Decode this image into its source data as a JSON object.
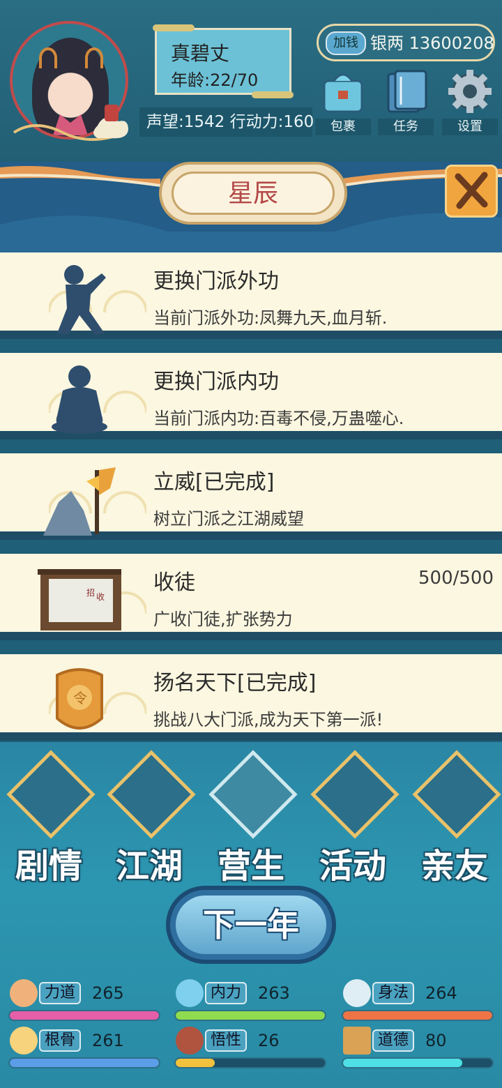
{
  "header": {
    "name": "真碧丈",
    "age": "年龄:22/70",
    "stats_line": "声望:1542 行动力:160",
    "money_button": "加钱",
    "money_text": "银两 13600208",
    "icons": [
      {
        "label": "包裹",
        "icon": "bag-icon",
        "color": "#6ec6de"
      },
      {
        "label": "任务",
        "icon": "task-book-icon",
        "color": "#5a9bc8"
      },
      {
        "label": "设置",
        "icon": "gear-icon",
        "color": "#9fb4c4"
      }
    ]
  },
  "banner": {
    "title": "星辰"
  },
  "list": [
    {
      "title": "更换门派外功",
      "desc": "当前门派外功:凤舞九天,血月斩.",
      "count": "",
      "icon": "martial-stance-icon",
      "color": "#2f4e6e"
    },
    {
      "title": "更换门派内功",
      "desc": "当前门派内功:百毒不侵,万蛊噬心.",
      "count": "",
      "icon": "meditation-icon",
      "color": "#2f4e6e"
    },
    {
      "title": "立威[已完成]",
      "desc": "树立门派之江湖威望",
      "count": "",
      "icon": "flag-rock-icon",
      "color": "#e9a23b"
    },
    {
      "title": "收徒",
      "desc": "广收门徒,扩张势力",
      "count": "500/500",
      "icon": "recruit-board-icon",
      "color": "#6b4a2f"
    },
    {
      "title": "扬名天下[已完成]",
      "desc": "挑战八大门派,成为天下第一派!",
      "count": "",
      "icon": "token-badge-icon",
      "color": "#e59a3b"
    }
  ],
  "nav": [
    {
      "label": "剧情",
      "icon": "story-icon",
      "active": false
    },
    {
      "label": "江湖",
      "icon": "jianghu-icon",
      "active": false
    },
    {
      "label": "营生",
      "icon": "abacus-icon",
      "active": true
    },
    {
      "label": "活动",
      "icon": "activity-scroll-icon",
      "active": false
    },
    {
      "label": "亲友",
      "icon": "friends-icon",
      "active": false
    }
  ],
  "next_year": "下一年",
  "stats": [
    {
      "name": "力道",
      "value": "265",
      "icon": "muscle-icon",
      "fill": 1.0,
      "color": "#e45fa8"
    },
    {
      "name": "内力",
      "value": "263",
      "icon": "inner-energy-icon",
      "fill": 1.0,
      "color": "#8fdc4f"
    },
    {
      "name": "身法",
      "value": "264",
      "icon": "swallow-icon",
      "fill": 1.0,
      "color": "#ee7446"
    },
    {
      "name": "根骨",
      "value": "261",
      "icon": "aura-figure-icon",
      "fill": 1.0,
      "color": "#5b9de6"
    },
    {
      "name": "悟性",
      "value": "26",
      "icon": "brain-icon",
      "fill": 0.26,
      "color": "#f2c23c"
    },
    {
      "name": "道德",
      "value": "80",
      "icon": "book-icon",
      "fill": 0.8,
      "color": "#4ee0e4"
    }
  ]
}
